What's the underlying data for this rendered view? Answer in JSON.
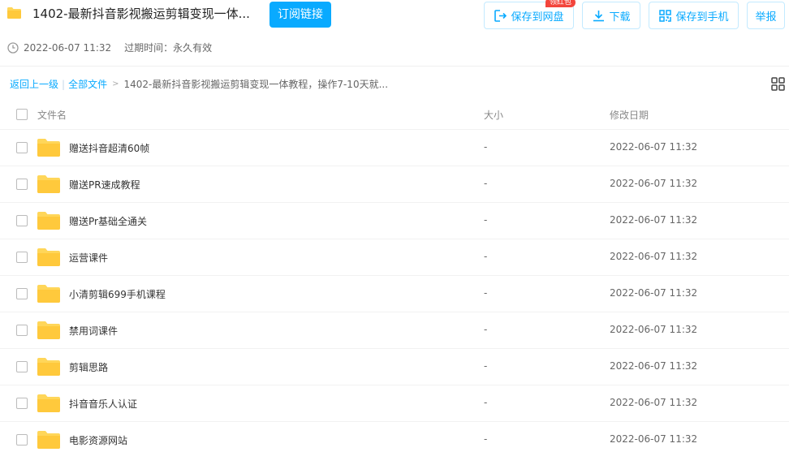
{
  "header": {
    "title": "1402-最新抖音影视搬运剪辑变现一体...",
    "subscribe_label": "订阅链接",
    "save_to_pan_label": "保存到网盘",
    "save_badge": "领红包",
    "download_label": "下载",
    "save_to_phone_label": "保存到手机",
    "report_label": "举报",
    "date": "2022-06-07 11:32",
    "expire_text": "过期时间：永久有效"
  },
  "breadcrumb": {
    "back": "返回上一级",
    "all_files": "全部文件",
    "current": "1402-最新抖音影视搬运剪辑变现一体教程，操作7-10天就..."
  },
  "table": {
    "columns": {
      "name": "文件名",
      "size": "大小",
      "date": "修改日期"
    },
    "rows": [
      {
        "name": "赠送抖音超清60帧",
        "size": "-",
        "date": "2022-06-07 11:32"
      },
      {
        "name": "赠送PR速成教程",
        "size": "-",
        "date": "2022-06-07 11:32"
      },
      {
        "name": "赠送Pr基础全通关",
        "size": "-",
        "date": "2022-06-07 11:32"
      },
      {
        "name": "运营课件",
        "size": "-",
        "date": "2022-06-07 11:32"
      },
      {
        "name": "小清剪辑699手机课程",
        "size": "-",
        "date": "2022-06-07 11:32"
      },
      {
        "name": "禁用词课件",
        "size": "-",
        "date": "2022-06-07 11:32"
      },
      {
        "name": "剪辑思路",
        "size": "-",
        "date": "2022-06-07 11:32"
      },
      {
        "name": "抖音音乐人认证",
        "size": "-",
        "date": "2022-06-07 11:32"
      },
      {
        "name": "电影资源网站",
        "size": "-",
        "date": "2022-06-07 11:32"
      }
    ]
  },
  "colors": {
    "accent": "#09aaff",
    "folder": "#ffd659",
    "badge": "#f3453c"
  },
  "icons": [
    "folder-icon",
    "save-to-pan-icon",
    "download-icon",
    "phone-icon",
    "clock-icon",
    "grid-view-icon"
  ]
}
